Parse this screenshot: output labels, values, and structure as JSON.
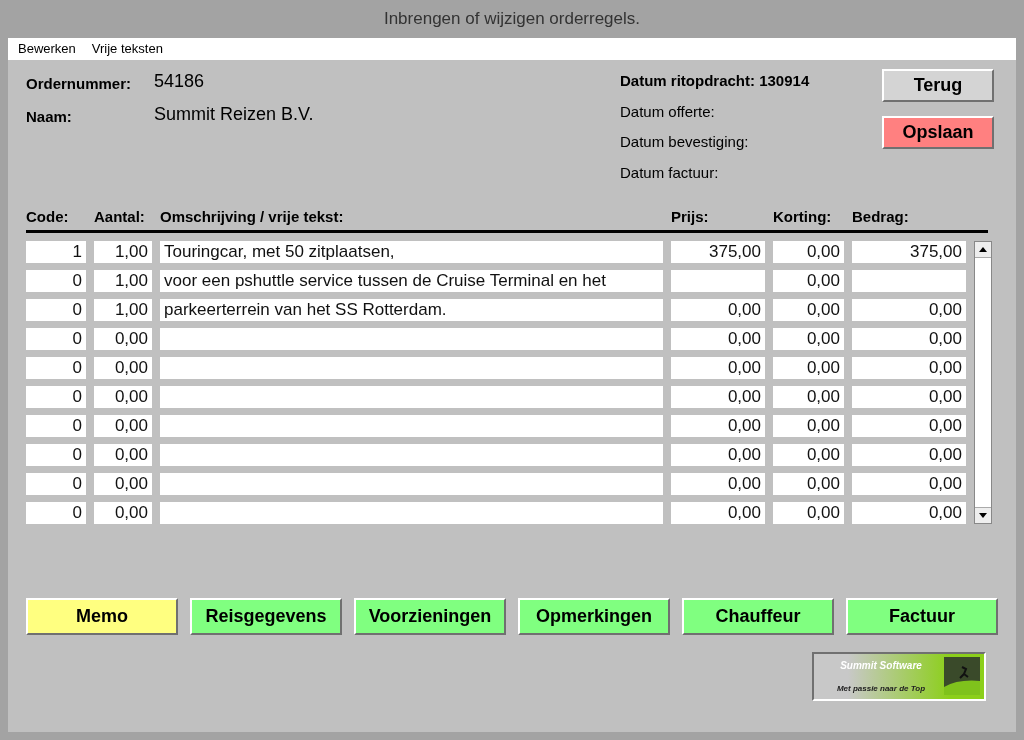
{
  "window": {
    "title": "Inbrengen of wijzigen orderregels."
  },
  "menu": [
    "Bewerken",
    "Vrije teksten"
  ],
  "order": {
    "number_label": "Ordernummer:",
    "number": "54186",
    "name_label": "Naam:",
    "name": "Summit Reizen B.V."
  },
  "dates": [
    "Datum ritopdracht: 130914",
    "Datum offerte:",
    "Datum bevestiging:",
    "Datum factuur:"
  ],
  "top_buttons": [
    {
      "label": "Terug",
      "color": "#d4d4d4"
    },
    {
      "label": "Opslaan",
      "color": "#ff8080"
    }
  ],
  "table": {
    "columns": [
      "Code:",
      "Aantal:",
      "Omschrijving / vrije tekst:",
      "Prijs:",
      "Korting:",
      "Bedrag:"
    ],
    "rows": [
      {
        "code": "1",
        "aantal": "1,00",
        "omschrijving": "Touringcar, met 50 zitplaatsen,",
        "prijs": "375,00",
        "korting": "0,00",
        "bedrag": "375,00"
      },
      {
        "code": "0",
        "aantal": "1,00",
        "omschrijving": "voor een pshuttle service tussen de Cruise Terminal en het",
        "korting": "0,00"
      },
      {
        "code": "0",
        "aantal": "1,00",
        "omschrijving": "parkeerterrein van het SS Rotterdam.",
        "prijs": "0,00",
        "korting": "0,00",
        "bedrag": "0,00"
      },
      {
        "code": "0",
        "aantal": "0,00",
        "prijs": "0,00",
        "korting": "0,00",
        "bedrag": "0,00"
      },
      {
        "code": "0",
        "aantal": "0,00",
        "prijs": "0,00",
        "korting": "0,00",
        "bedrag": "0,00"
      },
      {
        "code": "0",
        "aantal": "0,00",
        "prijs": "0,00",
        "korting": "0,00",
        "bedrag": "0,00"
      },
      {
        "code": "0",
        "aantal": "0,00",
        "prijs": "0,00",
        "korting": "0,00",
        "bedrag": "0,00"
      },
      {
        "code": "0",
        "aantal": "0,00",
        "prijs": "0,00",
        "korting": "0,00",
        "bedrag": "0,00"
      },
      {
        "code": "0",
        "aantal": "0,00",
        "prijs": "0,00",
        "korting": "0,00",
        "bedrag": "0,00"
      },
      {
        "code": "0",
        "aantal": "0,00",
        "prijs": "0,00",
        "korting": "0,00",
        "bedrag": "0,00"
      }
    ]
  },
  "bottom_buttons": [
    {
      "label": "Memo",
      "color": "#ffff80"
    },
    {
      "label": "Reisgegevens",
      "color": "#80ff80"
    },
    {
      "label": "Voorzieningen",
      "color": "#80ff80"
    },
    {
      "label": "Opmerkingen",
      "color": "#80ff80"
    },
    {
      "label": "Chauffeur",
      "color": "#80ff80"
    },
    {
      "label": "Factuur",
      "color": "#80ff80"
    }
  ],
  "logo": {
    "title": "Summit Software",
    "slogan": "Met passie naar de Top"
  }
}
